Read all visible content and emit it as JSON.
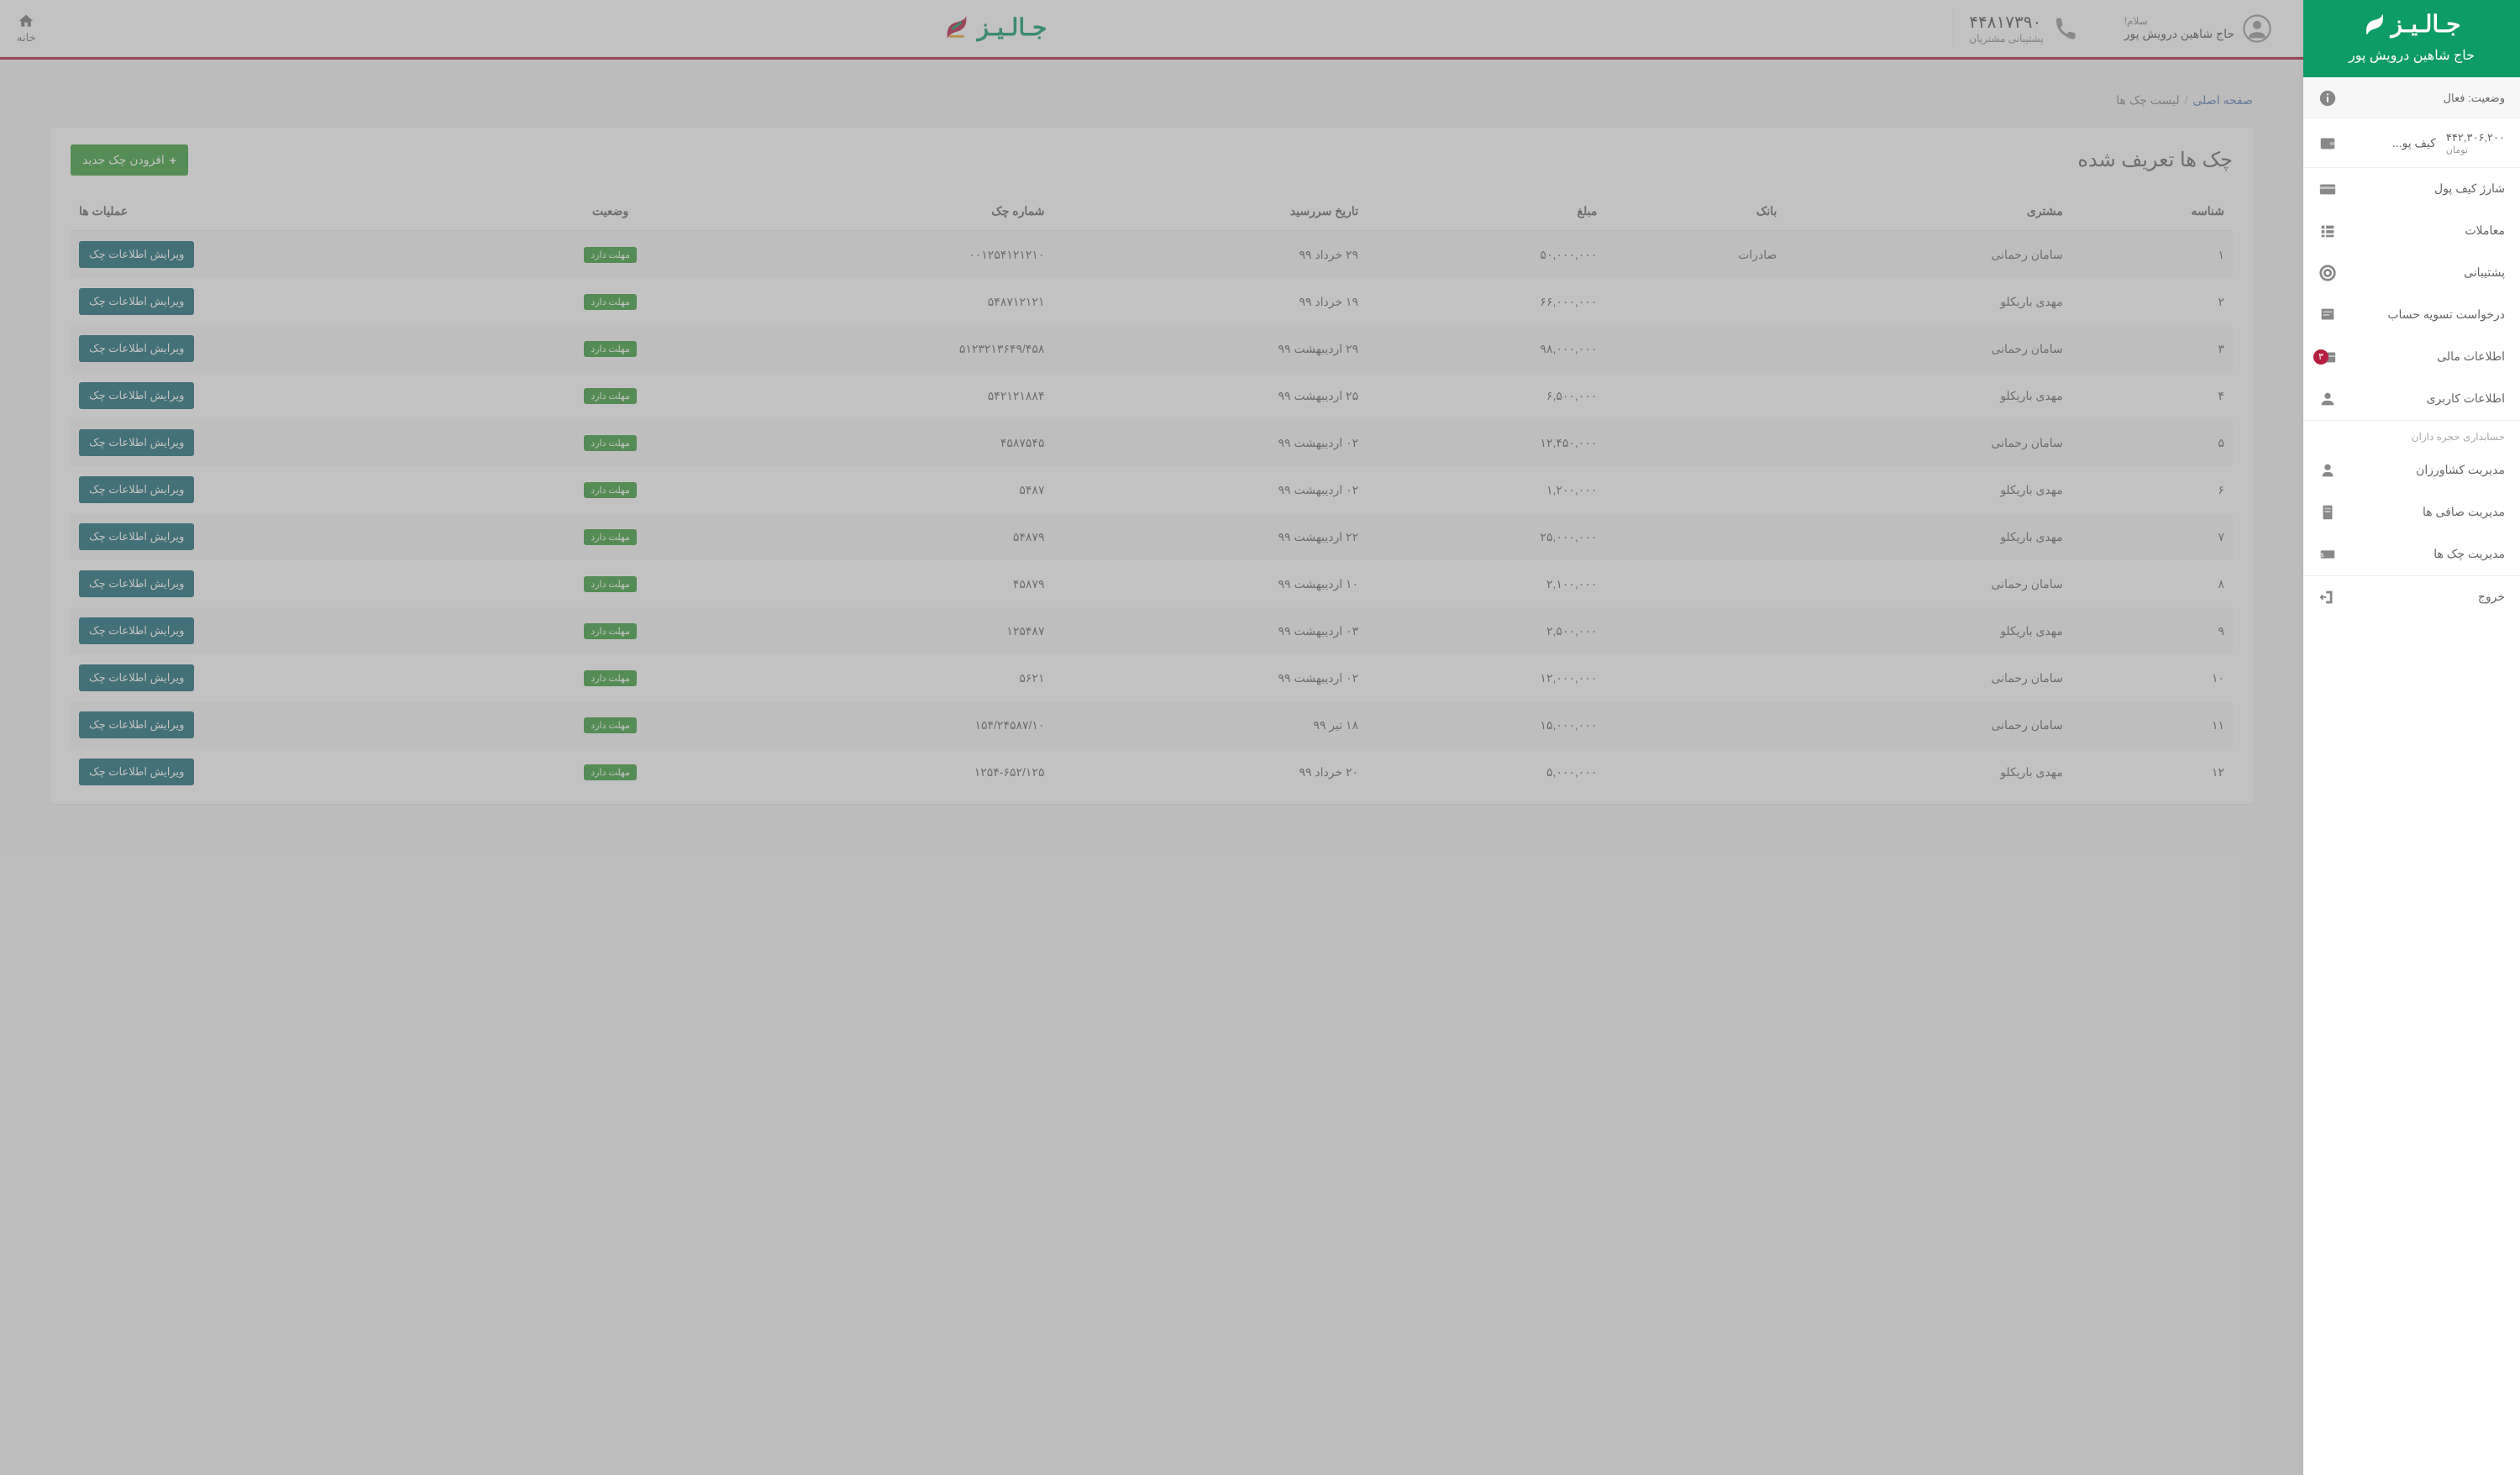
{
  "brand": {
    "name": "جـالـیـز"
  },
  "user": {
    "greeting": "سلام!",
    "name": "حاج شاهین درویش پور"
  },
  "phone": {
    "number": "۴۴۸۱۷۳۹۰",
    "label": "پشتیبانی مشتریان"
  },
  "home": "خانه",
  "sidebar": {
    "status_label": "وضعیت:",
    "status_value": "فعال",
    "wallet_label": "کیف پو...",
    "wallet_amount": "۴۴۲,۳۰۶,۲۰۰",
    "wallet_unit": "تومان",
    "items": {
      "charge": "شارژ کیف پول",
      "transactions": "معاملات",
      "support": "پشتیبانی",
      "settlement": "درخواست تسویه حساب",
      "financial": "اطلاعات مالی",
      "financial_badge": "۳",
      "profile": "اطلاعات کاربری"
    },
    "group": "حسابداری حجره داران",
    "group_items": {
      "farmers": "مدیریت کشاورزان",
      "safi": "مدیریت صافی ها",
      "checks": "مدیریت چک ها"
    },
    "logout": "خروج"
  },
  "breadcrumb": {
    "home": "صفحه اصلی",
    "current": "لیست چک ها"
  },
  "card": {
    "title": "چک ها تعریف شده",
    "add_btn": "افزودن چک جدید"
  },
  "table": {
    "headers": {
      "id": "شناسه",
      "customer": "مشتری",
      "bank": "بانک",
      "amount": "مبلغ",
      "due": "تاریخ سررسید",
      "check_no": "شماره چک",
      "status": "وضعیت",
      "ops": "عملیات ها"
    },
    "status_text": "مهلت دارد",
    "edit_btn": "ویرایش اطلاعات چک",
    "rows": [
      {
        "id": "۱",
        "customer": "سامان رحمانی",
        "bank": "صادرات",
        "amount": "۵۰,۰۰۰,۰۰۰",
        "due": "۲۹ خرداد ۹۹",
        "check_no": "۰۰۱۲۵۴۱۲۱۲۱۰"
      },
      {
        "id": "۲",
        "customer": "مهدی باریکلو",
        "bank": "",
        "amount": "۶۶,۰۰۰,۰۰۰",
        "due": "۱۹ خرداد ۹۹",
        "check_no": "۵۴۸۷۱۲۱۲۱"
      },
      {
        "id": "۳",
        "customer": "سامان رحمانی",
        "bank": "",
        "amount": "۹۸,۰۰۰,۰۰۰",
        "due": "۲۹ اردیبهشت ۹۹",
        "check_no": "۵۱۲۳۲۱۳۶۴۹/۴۵۸"
      },
      {
        "id": "۴",
        "customer": "مهدی باریکلو",
        "bank": "",
        "amount": "۶,۵۰۰,۰۰۰",
        "due": "۲۵ اردیبهشت ۹۹",
        "check_no": "۵۴۲۱۲۱۸۸۴"
      },
      {
        "id": "۵",
        "customer": "سامان رحمانی",
        "bank": "",
        "amount": "۱۲,۴۵۰,۰۰۰",
        "due": "۰۲ اردیبهشت ۹۹",
        "check_no": "۴۵۸۷۵۴۵"
      },
      {
        "id": "۶",
        "customer": "مهدی باریکلو",
        "bank": "",
        "amount": "۱,۲۰۰,۰۰۰",
        "due": "۰۲ اردیبهشت ۹۹",
        "check_no": "۵۴۸۷"
      },
      {
        "id": "۷",
        "customer": "مهدی باریکلو",
        "bank": "",
        "amount": "۲۵,۰۰۰,۰۰۰",
        "due": "۲۲ اردیبهشت ۹۹",
        "check_no": "۵۴۸۷۹"
      },
      {
        "id": "۸",
        "customer": "سامان رحمانی",
        "bank": "",
        "amount": "۲,۱۰۰,۰۰۰",
        "due": "۱۰ اردیبهشت ۹۹",
        "check_no": "۴۵۸۷۹"
      },
      {
        "id": "۹",
        "customer": "مهدی باریکلو",
        "bank": "",
        "amount": "۲,۵۰۰,۰۰۰",
        "due": "۰۳ اردیبهشت ۹۹",
        "check_no": "۱۲۵۴۸۷"
      },
      {
        "id": "۱۰",
        "customer": "سامان رحمانی",
        "bank": "",
        "amount": "۱۲,۰۰۰,۰۰۰",
        "due": "۰۲ اردیبهشت ۹۹",
        "check_no": "۵۶۲۱"
      },
      {
        "id": "۱۱",
        "customer": "سامان رحمانی",
        "bank": "",
        "amount": "۱۵,۰۰۰,۰۰۰",
        "due": "۱۸ تیر ۹۹",
        "check_no": "۱۵۴/۲۴۵۸۷/۱۰"
      },
      {
        "id": "۱۲",
        "customer": "مهدی باریکلو",
        "bank": "",
        "amount": "۵,۰۰۰,۰۰۰",
        "due": "۲۰ خرداد ۹۹",
        "check_no": "۱۲۵۴-۶۵۲/۱۲۵"
      }
    ]
  }
}
